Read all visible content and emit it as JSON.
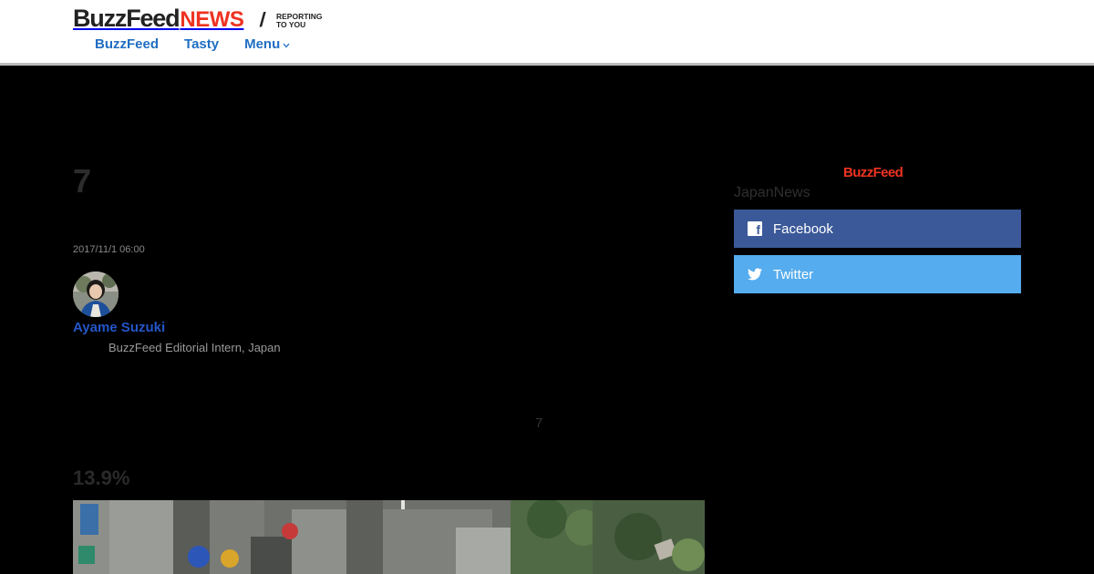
{
  "header": {
    "logo_primary": "BuzzFeed",
    "logo_secondary": "NEWS",
    "logo_separator": "/",
    "tagline_line1": "REPORTING",
    "tagline_line2": "TO YOU",
    "nav": [
      {
        "label": "BuzzFeed"
      },
      {
        "label": "Tasty"
      },
      {
        "label": "Menu"
      }
    ]
  },
  "article": {
    "headline": "7",
    "timestamp": "2017/11/1 06:00",
    "author": {
      "name": "Ayame Suzuki",
      "role": "BuzzFeed Editorial Intern, Japan"
    },
    "inline_number": "7",
    "stat": "13.9%"
  },
  "sidebar": {
    "brand": "BuzzFeed",
    "label": "JapanNews",
    "share": [
      {
        "label": "Facebook",
        "icon": "facebook-icon",
        "color": "#3b5998"
      },
      {
        "label": "Twitter",
        "icon": "twitter-icon",
        "color": "#55acee"
      }
    ]
  },
  "colors": {
    "accent_red": "#e32",
    "link_blue": "#1f6ec3",
    "author_blue": "#2456c8"
  }
}
